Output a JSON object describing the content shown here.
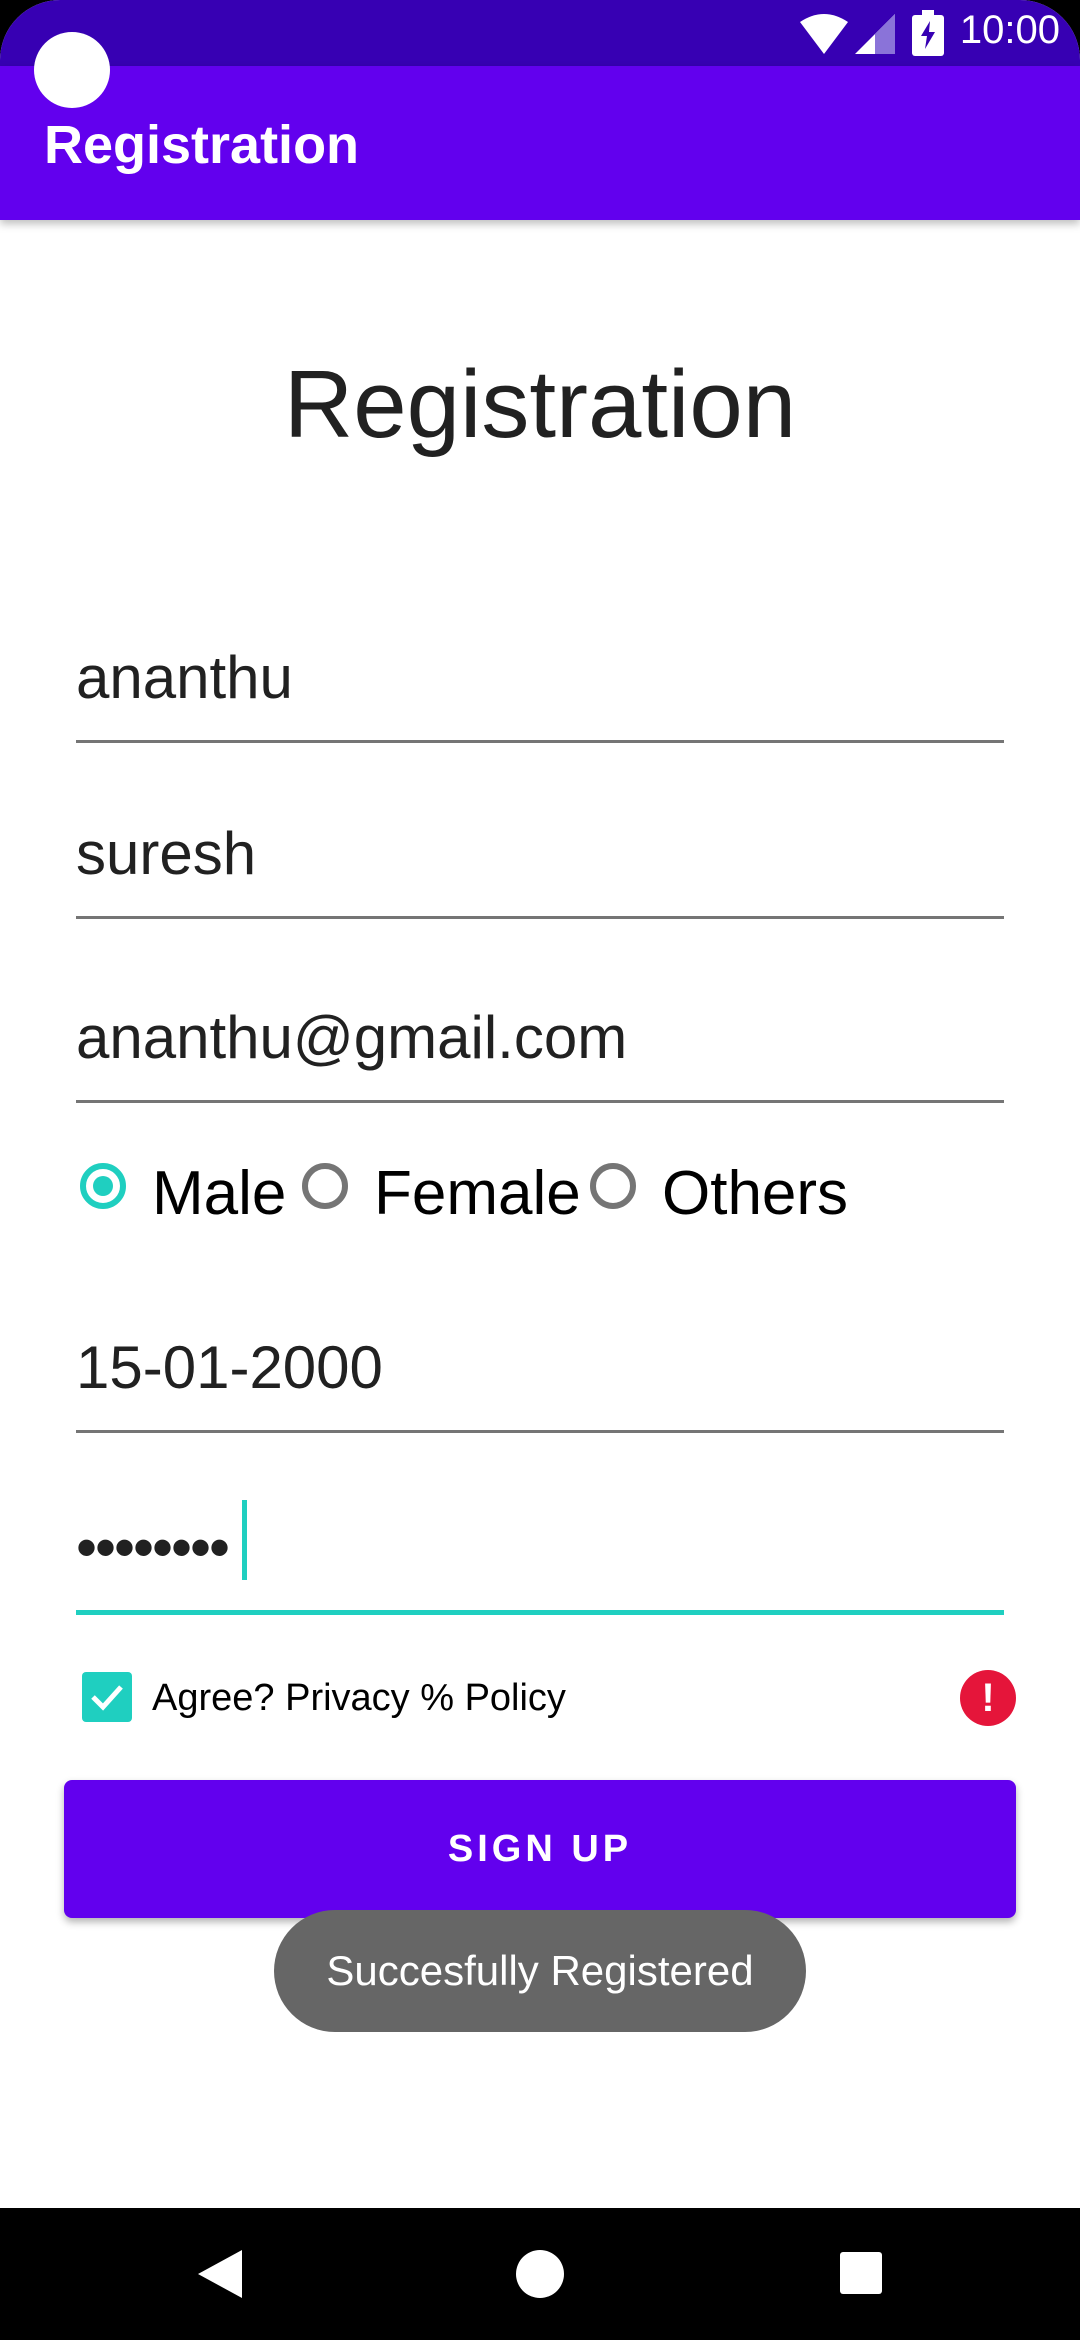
{
  "status_bar": {
    "time": "10:00"
  },
  "app_bar": {
    "title": "Registration"
  },
  "page": {
    "heading": "Registration"
  },
  "form": {
    "first_name": "ananthu",
    "last_name": "suresh",
    "email": "ananthu@gmail.com",
    "gender_options": [
      "Male",
      "Female",
      "Others"
    ],
    "gender_selected": "Male",
    "dob": "15-01-2000",
    "password_masked": "••••••••",
    "agree_label": "Agree? Privacy % Policy",
    "agree_checked": true,
    "signup_label": "SIGN UP"
  },
  "toast": {
    "message": "Succesfully Registered"
  },
  "colors": {
    "primary": "#6200EE",
    "primary_dark": "#3700B3",
    "accent": "#1FCFC0",
    "error": "#E5153A"
  },
  "icons": [
    "wifi-icon",
    "signal-icon",
    "battery-icon",
    "check-icon",
    "error-icon",
    "back-icon",
    "home-icon",
    "recents-icon"
  ]
}
